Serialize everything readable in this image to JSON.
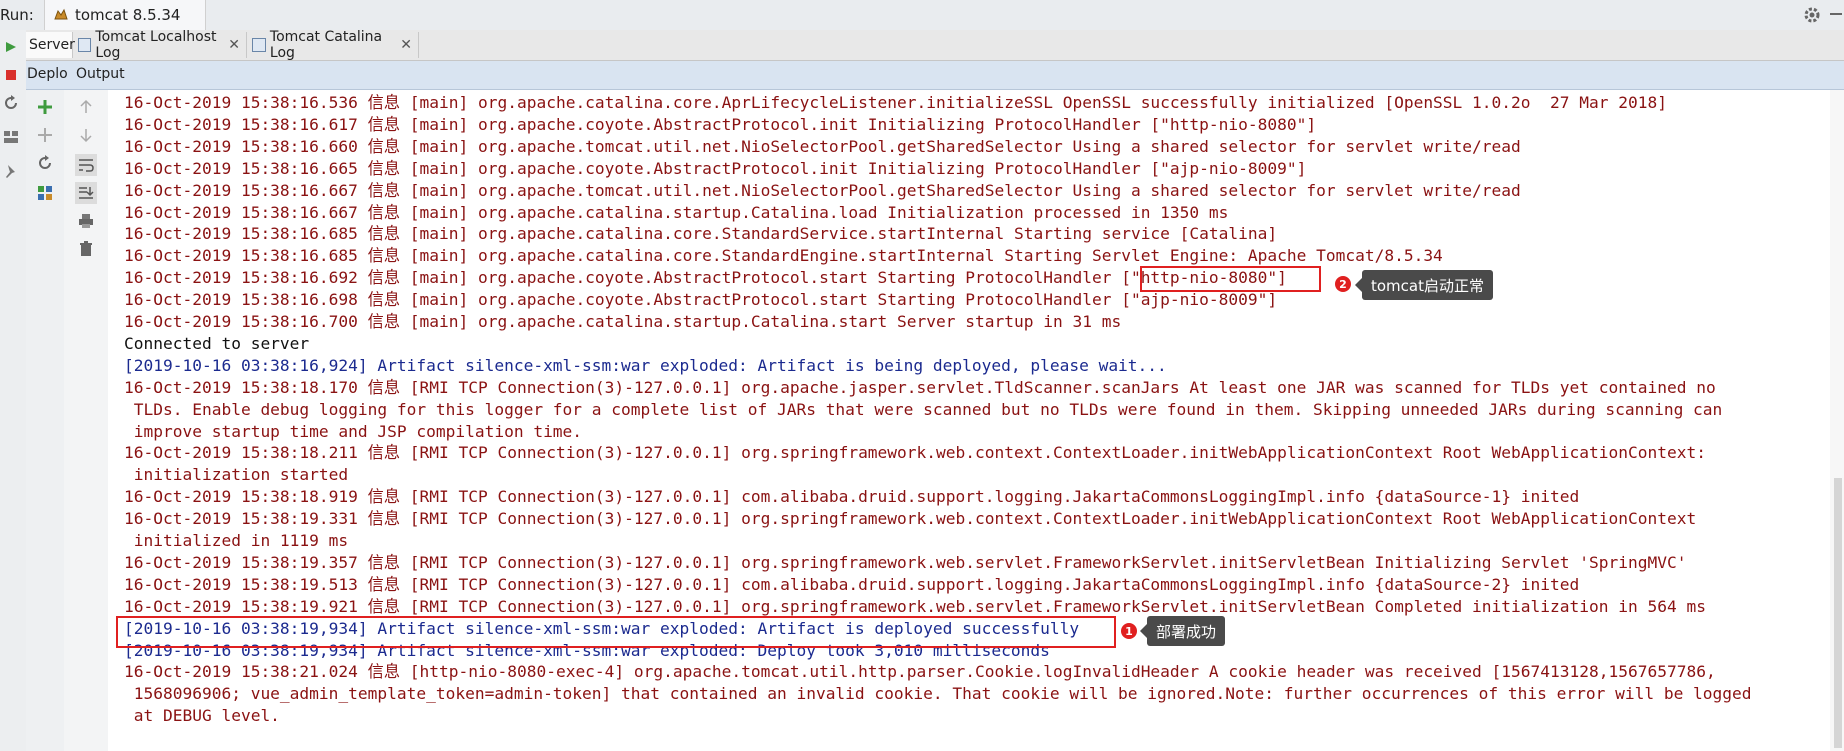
{
  "run": {
    "label": "Run:",
    "tab_title": "tomcat 8.5.34"
  },
  "tabs": [
    {
      "label": "Server"
    },
    {
      "label": "Tomcat Localhost Log",
      "close": "✕"
    },
    {
      "label": "Tomcat Catalina Log",
      "close": "✕"
    }
  ],
  "subtabs": [
    {
      "label": "Deplo"
    },
    {
      "label": "Output"
    }
  ],
  "console": {
    "lines": [
      {
        "text": "16-Oct-2019 15:38:16.536 信息 [main] org.apache.catalina.core.AprLifecycleListener.initializeSSL OpenSSL successfully initialized [OpenSSL 1.0.2o  27 Mar 2018]",
        "color": "red"
      },
      {
        "text": "16-Oct-2019 15:38:16.617 信息 [main] org.apache.coyote.AbstractProtocol.init Initializing ProtocolHandler [\"http-nio-8080\"]",
        "color": "red"
      },
      {
        "text": "16-Oct-2019 15:38:16.660 信息 [main] org.apache.tomcat.util.net.NioSelectorPool.getSharedSelector Using a shared selector for servlet write/read",
        "color": "red"
      },
      {
        "text": "16-Oct-2019 15:38:16.665 信息 [main] org.apache.coyote.AbstractProtocol.init Initializing ProtocolHandler [\"ajp-nio-8009\"]",
        "color": "red"
      },
      {
        "text": "16-Oct-2019 15:38:16.667 信息 [main] org.apache.tomcat.util.net.NioSelectorPool.getSharedSelector Using a shared selector for servlet write/read",
        "color": "red"
      },
      {
        "text": "16-Oct-2019 15:38:16.667 信息 [main] org.apache.catalina.startup.Catalina.load Initialization processed in 1350 ms",
        "color": "red"
      },
      {
        "text": "16-Oct-2019 15:38:16.685 信息 [main] org.apache.catalina.core.StandardService.startInternal Starting service [Catalina]",
        "color": "red"
      },
      {
        "text": "16-Oct-2019 15:38:16.685 信息 [main] org.apache.catalina.core.StandardEngine.startInternal Starting Servlet Engine: Apache Tomcat/8.5.34",
        "color": "red"
      },
      {
        "text": "16-Oct-2019 15:38:16.692 信息 [main] org.apache.coyote.AbstractProtocol.start Starting ProtocolHandler [\"http-nio-8080\"]",
        "color": "red"
      },
      {
        "text": "16-Oct-2019 15:38:16.698 信息 [main] org.apache.coyote.AbstractProtocol.start Starting ProtocolHandler [\"ajp-nio-8009\"]",
        "color": "red"
      },
      {
        "text": "16-Oct-2019 15:38:16.700 信息 [main] org.apache.catalina.startup.Catalina.start Server startup in 31 ms",
        "color": "red"
      },
      {
        "text": "Connected to server",
        "color": "black"
      },
      {
        "text": "[2019-10-16 03:38:16,924] Artifact silence-xml-ssm:war exploded: Artifact is being deployed, please wait...",
        "color": "blue"
      },
      {
        "text": "16-Oct-2019 15:38:18.170 信息 [RMI TCP Connection(3)-127.0.0.1] org.apache.jasper.servlet.TldScanner.scanJars At least one JAR was scanned for TLDs yet contained no",
        "color": "red"
      },
      {
        "text": " TLDs. Enable debug logging for this logger for a complete list of JARs that were scanned but no TLDs were found in them. Skipping unneeded JARs during scanning can",
        "color": "red"
      },
      {
        "text": " improve startup time and JSP compilation time.",
        "color": "red"
      },
      {
        "text": "16-Oct-2019 15:38:18.211 信息 [RMI TCP Connection(3)-127.0.0.1] org.springframework.web.context.ContextLoader.initWebApplicationContext Root WebApplicationContext:",
        "color": "red"
      },
      {
        "text": " initialization started",
        "color": "red"
      },
      {
        "text": "16-Oct-2019 15:38:18.919 信息 [RMI TCP Connection(3)-127.0.0.1] com.alibaba.druid.support.logging.JakartaCommonsLoggingImpl.info {dataSource-1} inited",
        "color": "red"
      },
      {
        "text": "16-Oct-2019 15:38:19.331 信息 [RMI TCP Connection(3)-127.0.0.1] org.springframework.web.context.ContextLoader.initWebApplicationContext Root WebApplicationContext",
        "color": "red"
      },
      {
        "text": " initialized in 1119 ms",
        "color": "red"
      },
      {
        "text": "16-Oct-2019 15:38:19.357 信息 [RMI TCP Connection(3)-127.0.0.1] org.springframework.web.servlet.FrameworkServlet.initServletBean Initializing Servlet 'SpringMVC'",
        "color": "red"
      },
      {
        "text": "16-Oct-2019 15:38:19.513 信息 [RMI TCP Connection(3)-127.0.0.1] com.alibaba.druid.support.logging.JakartaCommonsLoggingImpl.info {dataSource-2} inited",
        "color": "red"
      },
      {
        "text": "16-Oct-2019 15:38:19.921 信息 [RMI TCP Connection(3)-127.0.0.1] org.springframework.web.servlet.FrameworkServlet.initServletBean Completed initialization in 564 ms",
        "color": "red"
      },
      {
        "text": "[2019-10-16 03:38:19,934] Artifact silence-xml-ssm:war exploded: Artifact is deployed successfully",
        "color": "blue"
      },
      {
        "text": "[2019-10-16 03:38:19,934] Artifact silence-xml-ssm:war exploded: Deploy took 3,010 milliseconds",
        "color": "blue"
      },
      {
        "text": "16-Oct-2019 15:38:21.024 信息 [http-nio-8080-exec-4] org.apache.tomcat.util.http.parser.Cookie.logInvalidHeader A cookie header was received [1567413128,1567657786,",
        "color": "red"
      },
      {
        "text": " 1568096906; vue_admin_template_token=admin-token] that contained an invalid cookie. That cookie will be ignored.Note: further occurrences of this error will be logged",
        "color": "red"
      },
      {
        "text": " at DEBUG level.",
        "color": "red"
      }
    ]
  },
  "annotations": [
    {
      "number": "2",
      "text": "tomcat启动正常"
    },
    {
      "number": "1",
      "text": "部署成功"
    }
  ],
  "colors": {
    "log_red": "#8a1212",
    "log_blue": "#1b2a8f",
    "highlight": "#e02020"
  }
}
